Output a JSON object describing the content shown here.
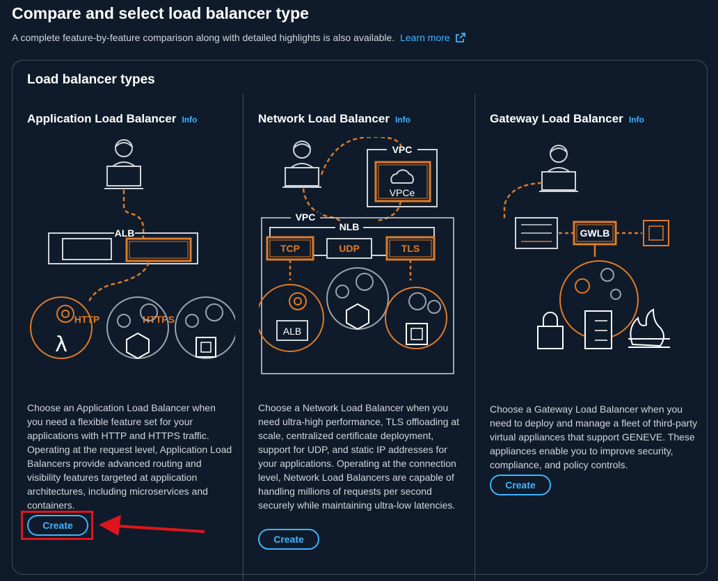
{
  "header": {
    "title": "Compare and select load balancer type",
    "subtitle": "A complete feature-by-feature comparison along with detailed highlights is also available.",
    "learn_more": "Learn more"
  },
  "panel": {
    "title": "Load balancer types",
    "info_label": "Info",
    "create_label": "Create",
    "columns": [
      {
        "title": "Application Load Balancer",
        "diagram": {
          "group": "ALB",
          "boxes": [
            "HTTP",
            "HTTPS"
          ]
        },
        "description": "Choose an Application Load Balancer when you need a flexible feature set for your applications with HTTP and HTTPS traffic. Operating at the request level, Application Load Balancers provide advanced routing and visibility features targeted at application architectures, including microservices and containers."
      },
      {
        "title": "Network Load Balancer",
        "diagram": {
          "vpc_top": "VPC",
          "vpce": "VPCe",
          "vpc": "VPC",
          "group": "NLB",
          "boxes": [
            "TCP",
            "UDP",
            "TLS"
          ],
          "target": "ALB"
        },
        "description": "Choose a Network Load Balancer when you need ultra-high performance, TLS offloading at scale, centralized certificate deployment, support for UDP, and static IP addresses for your applications. Operating at the connection level, Network Load Balancers are capable of handling millions of requests per second securely while maintaining ultra-low latencies."
      },
      {
        "title": "Gateway Load Balancer",
        "diagram": {
          "gwlb": "GWLB"
        },
        "description": "Choose a Gateway Load Balancer when you need to deploy and manage a fleet of third-party virtual appliances that support GENEVE. These appliances enable you to improve security, compliance, and policy controls."
      }
    ]
  },
  "colors": {
    "accent": "#42b4ff",
    "orange": "#e07b26",
    "annotation": "#e0151b"
  }
}
